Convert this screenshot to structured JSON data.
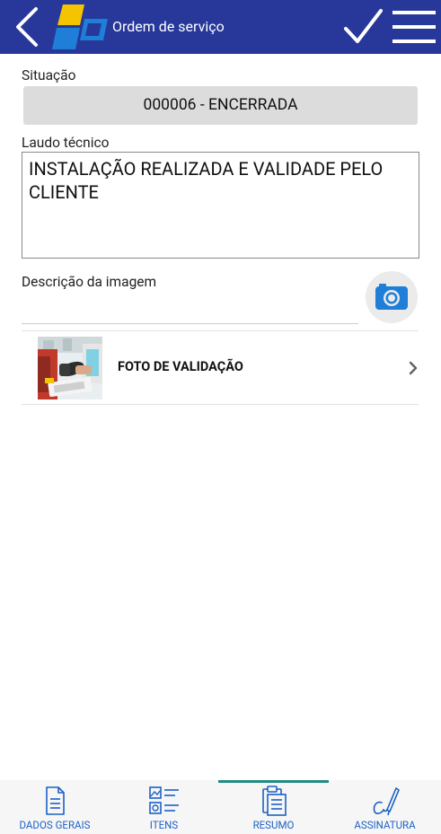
{
  "header": {
    "title": "Ordem de serviço"
  },
  "situacao": {
    "label": "Situação",
    "value": "000006 - ENCERRADA"
  },
  "laudo": {
    "label": "Laudo técnico",
    "value": "INSTALAÇÃO REALIZADA E VALIDADE PELO CLIENTE"
  },
  "descricao": {
    "label": "Descrição da imagem"
  },
  "photos": [
    {
      "label": "FOTO DE VALIDAÇÃO"
    }
  ],
  "tabs": [
    {
      "label": "DADOS GERAIS",
      "icon": "document-icon"
    },
    {
      "label": "ITENS",
      "icon": "item-list-icon"
    },
    {
      "label": "RESUMO",
      "icon": "clipboard-icon",
      "active": true
    },
    {
      "label": "ASSINATURA",
      "icon": "signature-icon"
    }
  ],
  "colors": {
    "header_bg": "#27389a",
    "accent": "#1d61c4",
    "active_tab_indicator": "#1f8a86",
    "logo_yellow": "#f5c400",
    "logo_blue": "#1e7ed8"
  }
}
